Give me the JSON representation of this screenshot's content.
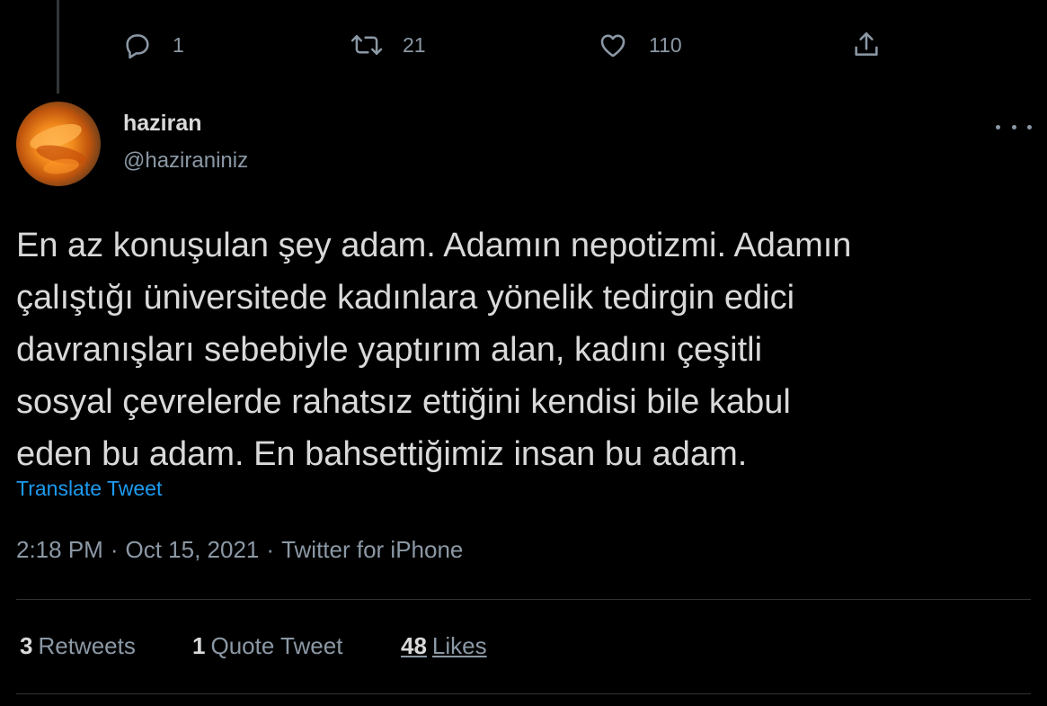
{
  "actions": {
    "reply_count": "1",
    "retweet_count": "21",
    "like_count": "110"
  },
  "user": {
    "display_name": "haziran",
    "handle": "@haziraniniz"
  },
  "tweet": {
    "lines": [
      "En az konuşulan şey adam. Adamın nepotizmi. Adamın",
      "çalıştığı üniversitede kadınlara yönelik tedirgin edici",
      "davranışları sebebiyle yaptırım alan, kadını çeşitli",
      "sosyal çevrelerde rahatsız ettiğini kendisi bile kabul",
      "eden bu adam. En bahsettiğimiz insan bu adam."
    ],
    "translate_label": "Translate Tweet",
    "time": "2:18 PM",
    "date": "Oct 15, 2021",
    "source": "Twitter for iPhone",
    "separator": "·"
  },
  "stats": {
    "retweets_num": "3",
    "retweets_label": "Retweets",
    "quotes_num": "1",
    "quotes_label": "Quote Tweet",
    "likes_num": "48",
    "likes_label": "Likes"
  },
  "icons": {
    "reply": "reply-icon",
    "retweet": "retweet-icon",
    "like": "heart-icon",
    "share": "share-icon",
    "more": "more-icon"
  },
  "colors": {
    "background": "#000000",
    "text": "#d9d9d9",
    "muted": "#8b98a5",
    "link": "#1d9bf0"
  }
}
